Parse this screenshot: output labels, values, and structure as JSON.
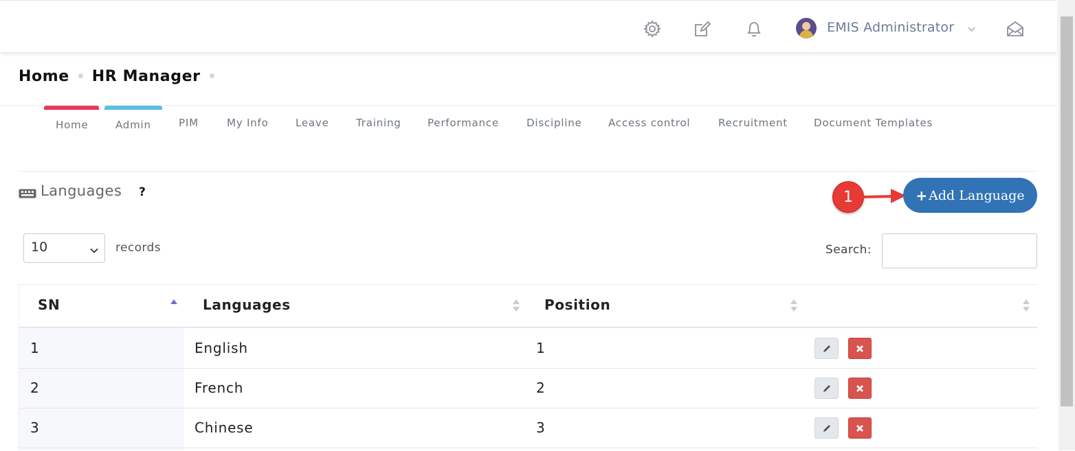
{
  "header": {
    "icons": [
      "gear-icon",
      "edit-icon",
      "bell-icon",
      "mail-open-icon"
    ],
    "user_name": "EMIS Administrator"
  },
  "breadcrumb": {
    "home": "Home",
    "current": "HR Manager"
  },
  "tabs": [
    {
      "label": "Home",
      "bar_color": "#e8385a"
    },
    {
      "label": "Admin",
      "bar_color": "#5bc0de"
    },
    {
      "label": "PIM"
    },
    {
      "label": "My Info"
    },
    {
      "label": "Leave"
    },
    {
      "label": "Training"
    },
    {
      "label": "Performance"
    },
    {
      "label": "Discipline"
    },
    {
      "label": "Access control"
    },
    {
      "label": "Recruitment"
    },
    {
      "label": "Document Templates"
    }
  ],
  "section": {
    "title": "Languages",
    "help": "?",
    "add_button": "Add Language",
    "annotation_number": "1"
  },
  "table_controls": {
    "page_length": "10",
    "records_label": "records",
    "search_label": "Search:"
  },
  "table": {
    "columns": [
      "SN",
      "Languages",
      "Position",
      ""
    ],
    "rows": [
      {
        "sn": "1",
        "language": "English",
        "position": "1"
      },
      {
        "sn": "2",
        "language": "French",
        "position": "2"
      },
      {
        "sn": "3",
        "language": "Chinese",
        "position": "3"
      }
    ]
  },
  "colors": {
    "primary": "#3173b5",
    "danger": "#d9534f",
    "annotation": "#e83a35"
  }
}
